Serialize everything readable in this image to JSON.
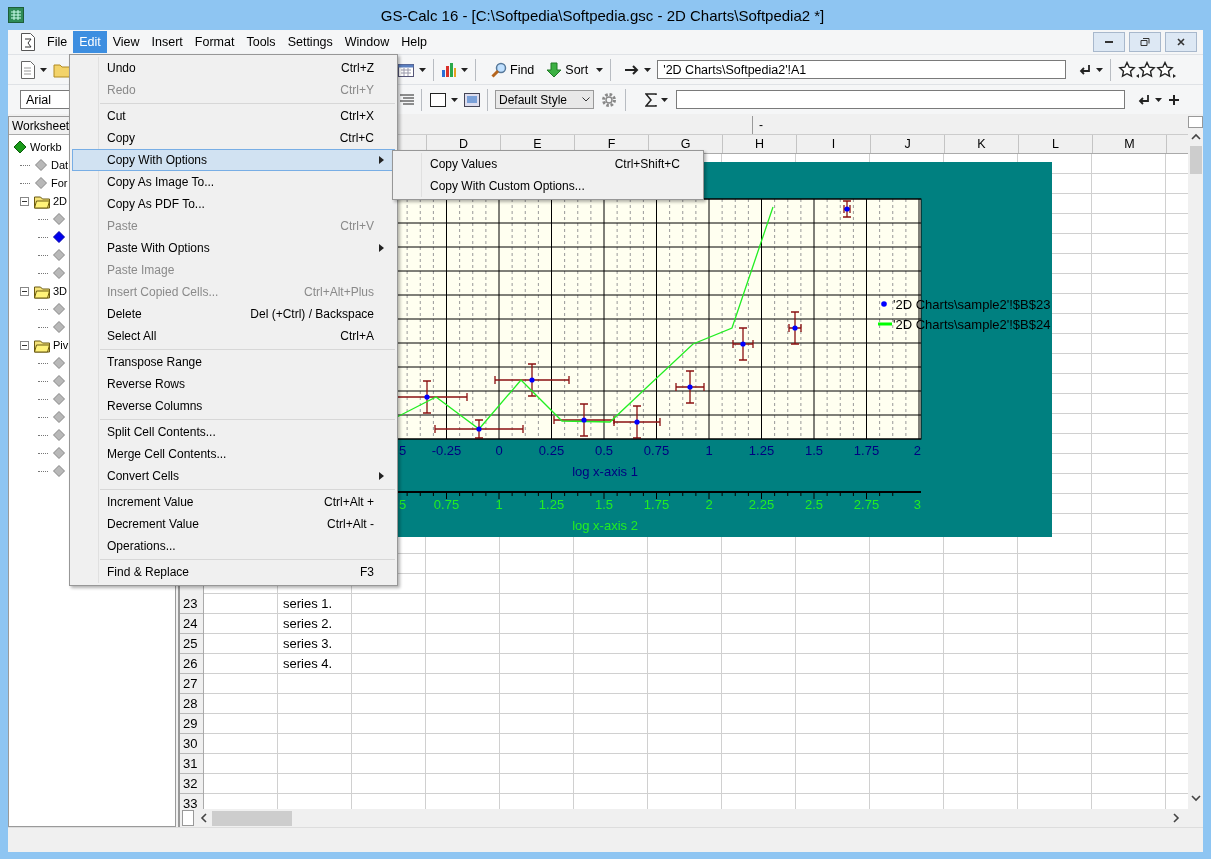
{
  "window": {
    "title": "GS-Calc 16 - [C:\\Softpedia\\Softpedia.gsc - 2D Charts\\Softpedia2 *]"
  },
  "menu_bar": [
    {
      "label": "File",
      "selected": false
    },
    {
      "label": "Edit",
      "selected": true
    },
    {
      "label": "View",
      "selected": false
    },
    {
      "label": "Insert",
      "selected": false
    },
    {
      "label": "Format",
      "selected": false
    },
    {
      "label": "Tools",
      "selected": false
    },
    {
      "label": "Settings",
      "selected": false
    },
    {
      "label": "Window",
      "selected": false
    },
    {
      "label": "Help",
      "selected": false
    }
  ],
  "toolbar": {
    "find_button": "Find",
    "sort_button": "Sort",
    "name_box": "'2D Charts\\Softpedia2'!A1",
    "font_field": "Arial",
    "style_select": "Default Style"
  },
  "sidebar": {
    "tab": "Worksheet",
    "tree": [
      {
        "kind": "workbook",
        "label": "Workb",
        "selected": false,
        "children": [
          {
            "kind": "sheet",
            "label": "Dat",
            "selected": false
          },
          {
            "kind": "sheet",
            "label": "For",
            "selected": false
          },
          {
            "kind": "folder",
            "label": "2D",
            "selected": false,
            "expanded": true,
            "children": [
              {
                "kind": "sheet",
                "selected": false
              },
              {
                "kind": "sheet",
                "selected": true
              },
              {
                "kind": "sheet",
                "selected": false
              },
              {
                "kind": "sheet",
                "selected": false
              }
            ]
          },
          {
            "kind": "folder",
            "label": "3D",
            "selected": false,
            "expanded": true,
            "children": [
              {
                "kind": "sheet",
                "selected": false
              },
              {
                "kind": "sheet",
                "selected": false
              }
            ]
          },
          {
            "kind": "folder",
            "label": "Piv",
            "selected": false,
            "expanded": true,
            "children": [
              {
                "kind": "sheet",
                "selected": false
              },
              {
                "kind": "sheet",
                "selected": false
              },
              {
                "kind": "sheet",
                "selected": false
              },
              {
                "kind": "sheet",
                "selected": false
              },
              {
                "kind": "sheet",
                "selected": false
              },
              {
                "kind": "sheet",
                "selected": false
              },
              {
                "kind": "sheet",
                "selected": false
              }
            ]
          }
        ]
      }
    ]
  },
  "sheet": {
    "split_bar": "-",
    "columns": [
      "D",
      "E",
      "F",
      "G",
      "H",
      "I",
      "J",
      "K",
      "L",
      "M"
    ],
    "rows": [
      {
        "header": "23",
        "column_2": "series 1."
      },
      {
        "header": "24",
        "column_2": "series 2."
      },
      {
        "header": "25",
        "column_2": "series 3."
      },
      {
        "header": "26",
        "column_2": "series 4."
      },
      {
        "header": "27"
      },
      {
        "header": "28"
      },
      {
        "header": "29"
      },
      {
        "header": "30"
      },
      {
        "header": "31"
      },
      {
        "header": "32"
      },
      {
        "header": "33"
      }
    ],
    "chart": {
      "axis_1": {
        "title": "log x-axis 1",
        "ticks": [
          "5",
          "-0.25",
          "0",
          "0.25",
          "0.5",
          "0.75",
          "1",
          "1.25",
          "1.5",
          "1.75",
          "2"
        ]
      },
      "axis_2": {
        "title": "log x-axis 2",
        "ticks": [
          "5",
          "0.75",
          "1",
          "1.25",
          "1.5",
          "1.75",
          "2",
          "2.25",
          "2.5",
          "2.75",
          "3"
        ]
      },
      "legend": [
        {
          "kind": "marker",
          "label": "'2D Charts\\sample2'!$B$23",
          "color": "#0000ff"
        },
        {
          "kind": "line",
          "label": "'2D Charts\\sample2'!$B$24",
          "color": "#00ff00"
        }
      ]
    }
  },
  "edit_menu": {
    "items": [
      {
        "kind": "item",
        "label": "Undo",
        "shortcut": "Ctrl+Z",
        "disabled": false,
        "selected": false,
        "submenu": false
      },
      {
        "kind": "item",
        "label": "Redo",
        "shortcut": "Ctrl+Y",
        "disabled": true,
        "selected": false,
        "submenu": false
      },
      {
        "kind": "separator"
      },
      {
        "kind": "item",
        "label": "Cut",
        "shortcut": "Ctrl+X",
        "disabled": false,
        "selected": false,
        "submenu": false
      },
      {
        "kind": "item",
        "label": "Copy",
        "shortcut": "Ctrl+C",
        "disabled": false,
        "selected": false,
        "submenu": false
      },
      {
        "kind": "item",
        "label": "Copy With Options",
        "disabled": false,
        "selected": true,
        "submenu": true
      },
      {
        "kind": "item",
        "label": "Copy As Image To...",
        "disabled": false,
        "selected": false,
        "submenu": false
      },
      {
        "kind": "item",
        "label": "Copy As PDF To...",
        "disabled": false,
        "selected": false,
        "submenu": false
      },
      {
        "kind": "item",
        "label": "Paste",
        "shortcut": "Ctrl+V",
        "disabled": true,
        "selected": false,
        "submenu": false
      },
      {
        "kind": "item",
        "label": "Paste With Options",
        "disabled": false,
        "selected": false,
        "submenu": true
      },
      {
        "kind": "item",
        "label": "Paste Image",
        "disabled": true,
        "selected": false,
        "submenu": false
      },
      {
        "kind": "item",
        "label": "Insert Copied Cells...",
        "shortcut": "Ctrl+Alt+Plus",
        "disabled": true,
        "selected": false,
        "submenu": false
      },
      {
        "kind": "item",
        "label": "Delete",
        "shortcut": "Del (+Ctrl) / Backspace",
        "disabled": false,
        "selected": false,
        "submenu": false
      },
      {
        "kind": "item",
        "label": "Select All",
        "shortcut": "Ctrl+A",
        "disabled": false,
        "selected": false,
        "submenu": false
      },
      {
        "kind": "separator"
      },
      {
        "kind": "item",
        "label": "Transpose Range",
        "disabled": false,
        "selected": false,
        "submenu": false
      },
      {
        "kind": "item",
        "label": "Reverse Rows",
        "disabled": false,
        "selected": false,
        "submenu": false
      },
      {
        "kind": "item",
        "label": "Reverse Columns",
        "disabled": false,
        "selected": false,
        "submenu": false
      },
      {
        "kind": "separator"
      },
      {
        "kind": "item",
        "label": "Split Cell Contents...",
        "disabled": false,
        "selected": false,
        "submenu": false
      },
      {
        "kind": "item",
        "label": "Merge Cell Contents...",
        "disabled": false,
        "selected": false,
        "submenu": false
      },
      {
        "kind": "item",
        "label": "Convert Cells",
        "disabled": false,
        "selected": false,
        "submenu": true
      },
      {
        "kind": "separator"
      },
      {
        "kind": "item",
        "label": "Increment Value",
        "shortcut": "Ctrl+Alt +",
        "disabled": false,
        "selected": false,
        "submenu": false
      },
      {
        "kind": "item",
        "label": "Decrement Value",
        "shortcut": "Ctrl+Alt -",
        "disabled": false,
        "selected": false,
        "submenu": false
      },
      {
        "kind": "item",
        "label": "Operations...",
        "disabled": false,
        "selected": false,
        "submenu": false
      },
      {
        "kind": "separator"
      },
      {
        "kind": "item",
        "label": "Find & Replace",
        "shortcut": "F3",
        "disabled": false,
        "selected": false,
        "submenu": false
      }
    ]
  },
  "submenu": {
    "items": [
      {
        "label": "Copy Values",
        "shortcut": "Ctrl+Shift+C",
        "selected": false
      },
      {
        "label": "Copy With Custom Options...",
        "selected": false
      }
    ]
  }
}
